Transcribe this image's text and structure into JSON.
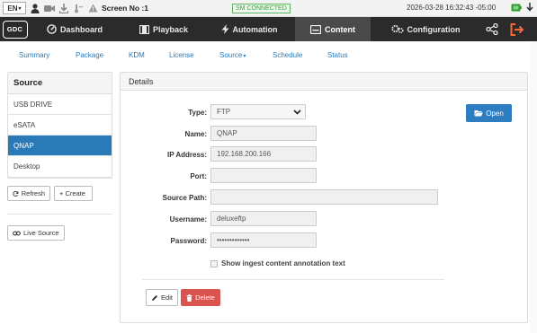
{
  "statusbar": {
    "language": "EN",
    "screen_label": "Screen No :1",
    "sm_status": "SM CONNECTED",
    "datetime": "2026-03-28 16:32:43 -05:00",
    "colors": {
      "connected": "#5cb85c",
      "battery": "#2e9a2e"
    }
  },
  "logo": {
    "text": "GDC"
  },
  "nav": {
    "items": [
      {
        "label": "Dashboard",
        "icon": "dashboard-icon"
      },
      {
        "label": "Playback",
        "icon": "film-icon"
      },
      {
        "label": "Automation",
        "icon": "bolt-icon"
      },
      {
        "label": "Content",
        "icon": "content-icon",
        "active": true
      },
      {
        "label": "Configuration",
        "icon": "gears-icon"
      }
    ],
    "right_icons": [
      "share-icon",
      "logout-icon"
    ],
    "colors": {
      "bar": "#2b2b2b",
      "active": "#4a4a4a",
      "logout": "#f26a3d"
    }
  },
  "subnav": {
    "items": [
      "Summary",
      "Package",
      "KDM",
      "License",
      "Source",
      "Schedule",
      "Status"
    ]
  },
  "sidebar": {
    "title": "Source",
    "items": [
      {
        "label": "USB DRIVE"
      },
      {
        "label": "eSATA"
      },
      {
        "label": "QNAP",
        "active": true
      },
      {
        "label": "Desktop"
      }
    ],
    "refresh_label": "Refresh",
    "create_label": "+ Create",
    "live_source_label": "Live Source",
    "accent": "#2a7ab8"
  },
  "details": {
    "title": "Details",
    "open_label": "Open",
    "fields": {
      "type": {
        "label": "Type:",
        "value": "FTP"
      },
      "name": {
        "label": "Name:",
        "value": "QNAP"
      },
      "ip": {
        "label": "IP Address:",
        "value": "192.168.200.166"
      },
      "port": {
        "label": "Port:",
        "value": ""
      },
      "source_path": {
        "label": "Source Path:",
        "value": ""
      },
      "username": {
        "label": "Username:",
        "value": "deluxeftp"
      },
      "password": {
        "label": "Password:",
        "value": "•••••••••••••"
      }
    },
    "checkbox_label": "Show ingest content annotation text",
    "checkbox_checked": false,
    "edit_label": "Edit",
    "delete_label": "Delete",
    "colors": {
      "open": "#2f7dc1",
      "delete": "#d9534f"
    }
  }
}
